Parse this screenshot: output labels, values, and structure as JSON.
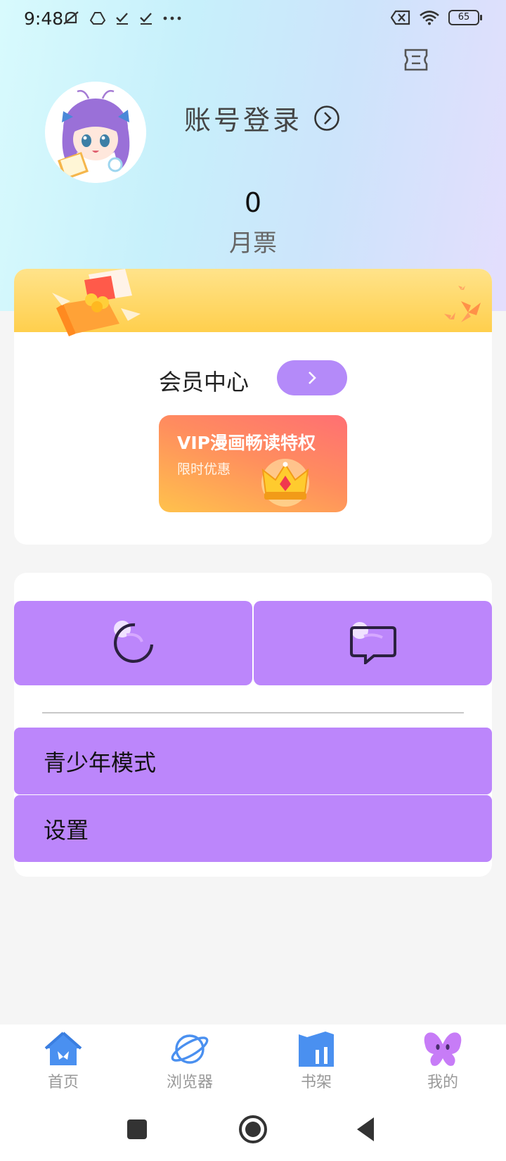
{
  "status_bar": {
    "time": "9:48",
    "left_icons": [
      "mute-bell-icon",
      "drive-icon",
      "check-icon",
      "check-icon",
      "more-dots-icon"
    ],
    "right_icons": [
      "sim-off-icon",
      "wifi-icon"
    ],
    "battery": "65"
  },
  "header": {
    "login_label": "账号登录",
    "ticket_count": "0",
    "ticket_label": "月票"
  },
  "member": {
    "title": "会员中心",
    "vip_title": "VIP漫画畅读特权",
    "vip_subtitle": "限时优惠"
  },
  "functions": {
    "menu": [
      {
        "label": "青少年模式"
      },
      {
        "label": "设置"
      }
    ]
  },
  "tabs": [
    {
      "label": "首页",
      "icon": "home-icon"
    },
    {
      "label": "浏览器",
      "icon": "planet-icon"
    },
    {
      "label": "书架",
      "icon": "bookshelf-icon"
    },
    {
      "label": "我的",
      "icon": "butterfly-icon"
    }
  ],
  "colors": {
    "accent_purple": "#bc86fb",
    "tab_blue": "#4a90f0",
    "tab_purple": "#c77cf7"
  }
}
